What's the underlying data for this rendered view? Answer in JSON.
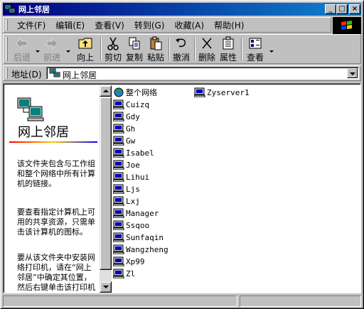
{
  "window": {
    "title": "网上邻居"
  },
  "titlebar_buttons": {
    "minimize": "_",
    "maximize": "□",
    "close": "×"
  },
  "menu": [
    {
      "label": "文件(F)"
    },
    {
      "label": "编辑(E)"
    },
    {
      "label": "查看(V)"
    },
    {
      "label": "转到(G)"
    },
    {
      "label": "收藏(A)"
    },
    {
      "label": "帮助(H)"
    }
  ],
  "toolbar": {
    "back": "后退",
    "forward": "前进",
    "up": "向上",
    "cut": "剪切",
    "copy": "复制",
    "paste": "粘贴",
    "undo": "撤消",
    "delete": "删除",
    "properties": "属性",
    "view": "查看"
  },
  "address": {
    "label": "地址(D)",
    "value": "网上邻居"
  },
  "infopane": {
    "title": "网上邻居",
    "para1": "该文件夹包含与工作组和整个网络中所有计算机的链接。",
    "para2": "要查看指定计算机上可用的共享资源，只需单击该计算机的图标。",
    "para3": "要从该文件夹中安装网络打印机，请在“网上邻居”中确定其位置，然后右键单击该打印机"
  },
  "files": [
    {
      "name": "整个网络",
      "icon": "entire-network-icon"
    },
    {
      "name": "Cuizq",
      "icon": "computer-icon"
    },
    {
      "name": "Gdy",
      "icon": "computer-icon"
    },
    {
      "name": "Gh",
      "icon": "computer-icon"
    },
    {
      "name": "Gw",
      "icon": "computer-icon"
    },
    {
      "name": "Isabel",
      "icon": "computer-icon"
    },
    {
      "name": "Joe",
      "icon": "computer-icon"
    },
    {
      "name": "Lihui",
      "icon": "computer-icon"
    },
    {
      "name": "Ljs",
      "icon": "computer-icon"
    },
    {
      "name": "Lxj",
      "icon": "computer-icon"
    },
    {
      "name": "Manager",
      "icon": "computer-icon"
    },
    {
      "name": "Ssqoo",
      "icon": "computer-icon"
    },
    {
      "name": "Sunfaqin",
      "icon": "computer-icon"
    },
    {
      "name": "Wangzheng",
      "icon": "computer-icon"
    },
    {
      "name": "Xp99",
      "icon": "computer-icon"
    },
    {
      "name": "Zl",
      "icon": "computer-icon"
    },
    {
      "name": "Zyserver1",
      "icon": "computer-icon"
    }
  ],
  "colors": {
    "title_bar": "#000080",
    "face": "#c0c0c0",
    "window_bg": "#ffffff"
  }
}
